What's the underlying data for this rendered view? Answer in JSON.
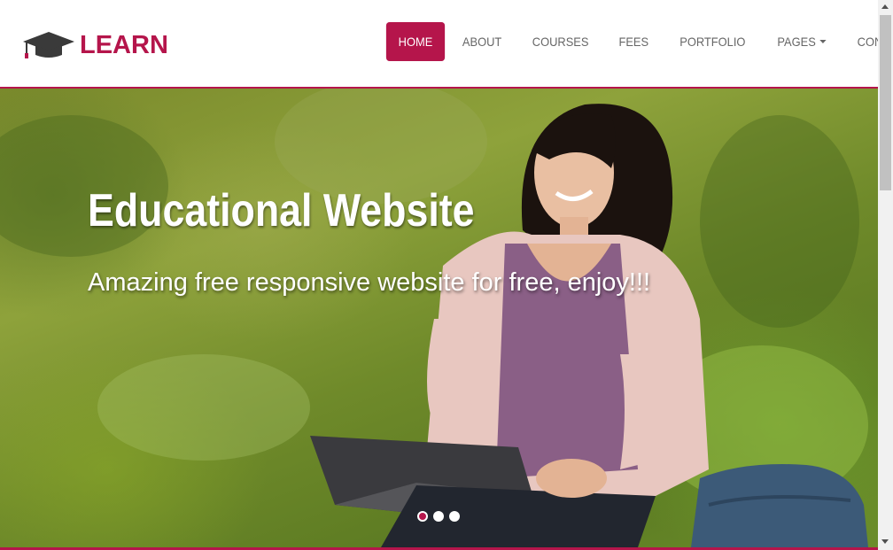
{
  "header": {
    "logo": {
      "text": "LEARN",
      "icon": "graduation-cap-icon"
    },
    "nav": [
      {
        "label": "HOME",
        "active": true
      },
      {
        "label": "ABOUT",
        "active": false
      },
      {
        "label": "COURSES",
        "active": false
      },
      {
        "label": "FEES",
        "active": false
      },
      {
        "label": "PORTFOLIO",
        "active": false
      },
      {
        "label": "PAGES",
        "active": false,
        "dropdown": true
      },
      {
        "label": "CONTACT",
        "active": false
      }
    ]
  },
  "hero": {
    "title": "Educational Website",
    "subtitle": "Amazing free responsive website for free, enjoy!!!",
    "slides": 3,
    "active_slide": 1
  },
  "colors": {
    "accent": "#b5154b",
    "nav_text": "#666666",
    "hero_text": "#ffffff"
  }
}
